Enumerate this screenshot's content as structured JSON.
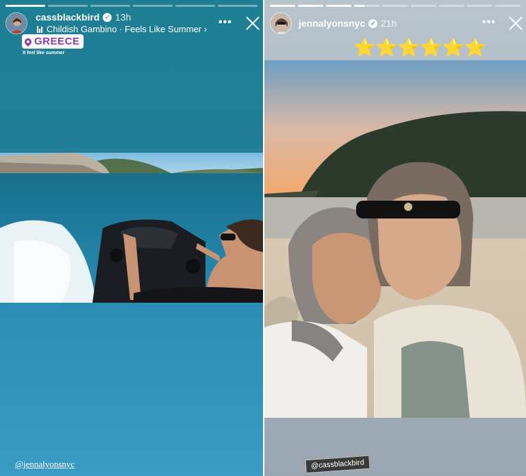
{
  "left_story": {
    "username": "cassblackbird",
    "time": "13h",
    "music": "Childish Gambino · Feels Like Summer ›",
    "location": "GREECE",
    "caption": "It feel like summer",
    "mention": "@jennalyonsnyc",
    "progress": {
      "segments": 6,
      "completed": 1
    }
  },
  "right_story": {
    "username": "jennalyonsnyc",
    "time": "21h",
    "stars": "⭐⭐⭐⭐⭐⭐",
    "mention": "@cassblackbird",
    "progress": {
      "segments": 9,
      "completed": 3
    }
  },
  "icons": {
    "verified": "verified-badge-icon",
    "more": "more-options-icon",
    "close": "close-icon",
    "music": "music-bars-icon",
    "location": "location-pin-icon"
  },
  "colors": {
    "left_background": "#217d97",
    "right_background": "#a9b6c0",
    "location_accent": "#8a3ab9",
    "verified_blue": "#3897f0"
  }
}
